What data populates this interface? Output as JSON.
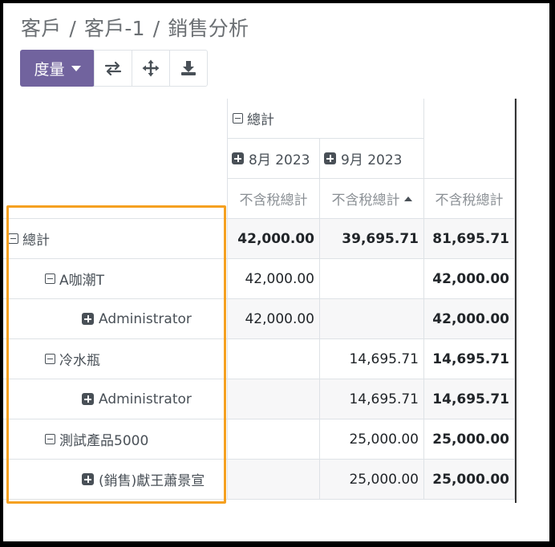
{
  "breadcrumb": [
    "客戶",
    "客戶-1",
    "銷售分析"
  ],
  "breadcrumb_sep": "/",
  "toolbar": {
    "measure_label": "度量",
    "icons": [
      "swap-axis-icon",
      "expand-all-icon",
      "download-icon"
    ]
  },
  "header": {
    "total_label": "總計",
    "months": [
      "8月 2023",
      "9月 2023"
    ],
    "measure": "不含稅總計"
  },
  "rows": [
    {
      "label": "總計",
      "level": 0,
      "icon": "minus",
      "values": [
        "42,000.00",
        "39,695.71",
        "81,695.71"
      ]
    },
    {
      "label": "A咖潮T",
      "level": 1,
      "icon": "minus",
      "values": [
        "42,000.00",
        "",
        "42,000.00"
      ]
    },
    {
      "label": "Administrator",
      "level": 2,
      "icon": "plus",
      "values": [
        "42,000.00",
        "",
        "42,000.00"
      ]
    },
    {
      "label": "冷水瓶",
      "level": 1,
      "icon": "minus",
      "values": [
        "",
        "14,695.71",
        "14,695.71"
      ]
    },
    {
      "label": "Administrator",
      "level": 2,
      "icon": "plus",
      "values": [
        "",
        "14,695.71",
        "14,695.71"
      ]
    },
    {
      "label": "測試產品5000",
      "level": 1,
      "icon": "minus",
      "values": [
        "",
        "25,000.00",
        "25,000.00"
      ]
    },
    {
      "label": "(銷售)獻王蕭景宣",
      "level": 2,
      "icon": "plus",
      "values": [
        "",
        "25,000.00",
        "25,000.00"
      ]
    }
  ],
  "colors": {
    "primary": "#71639e",
    "highlight": "#f5a020",
    "text": "#212529"
  }
}
